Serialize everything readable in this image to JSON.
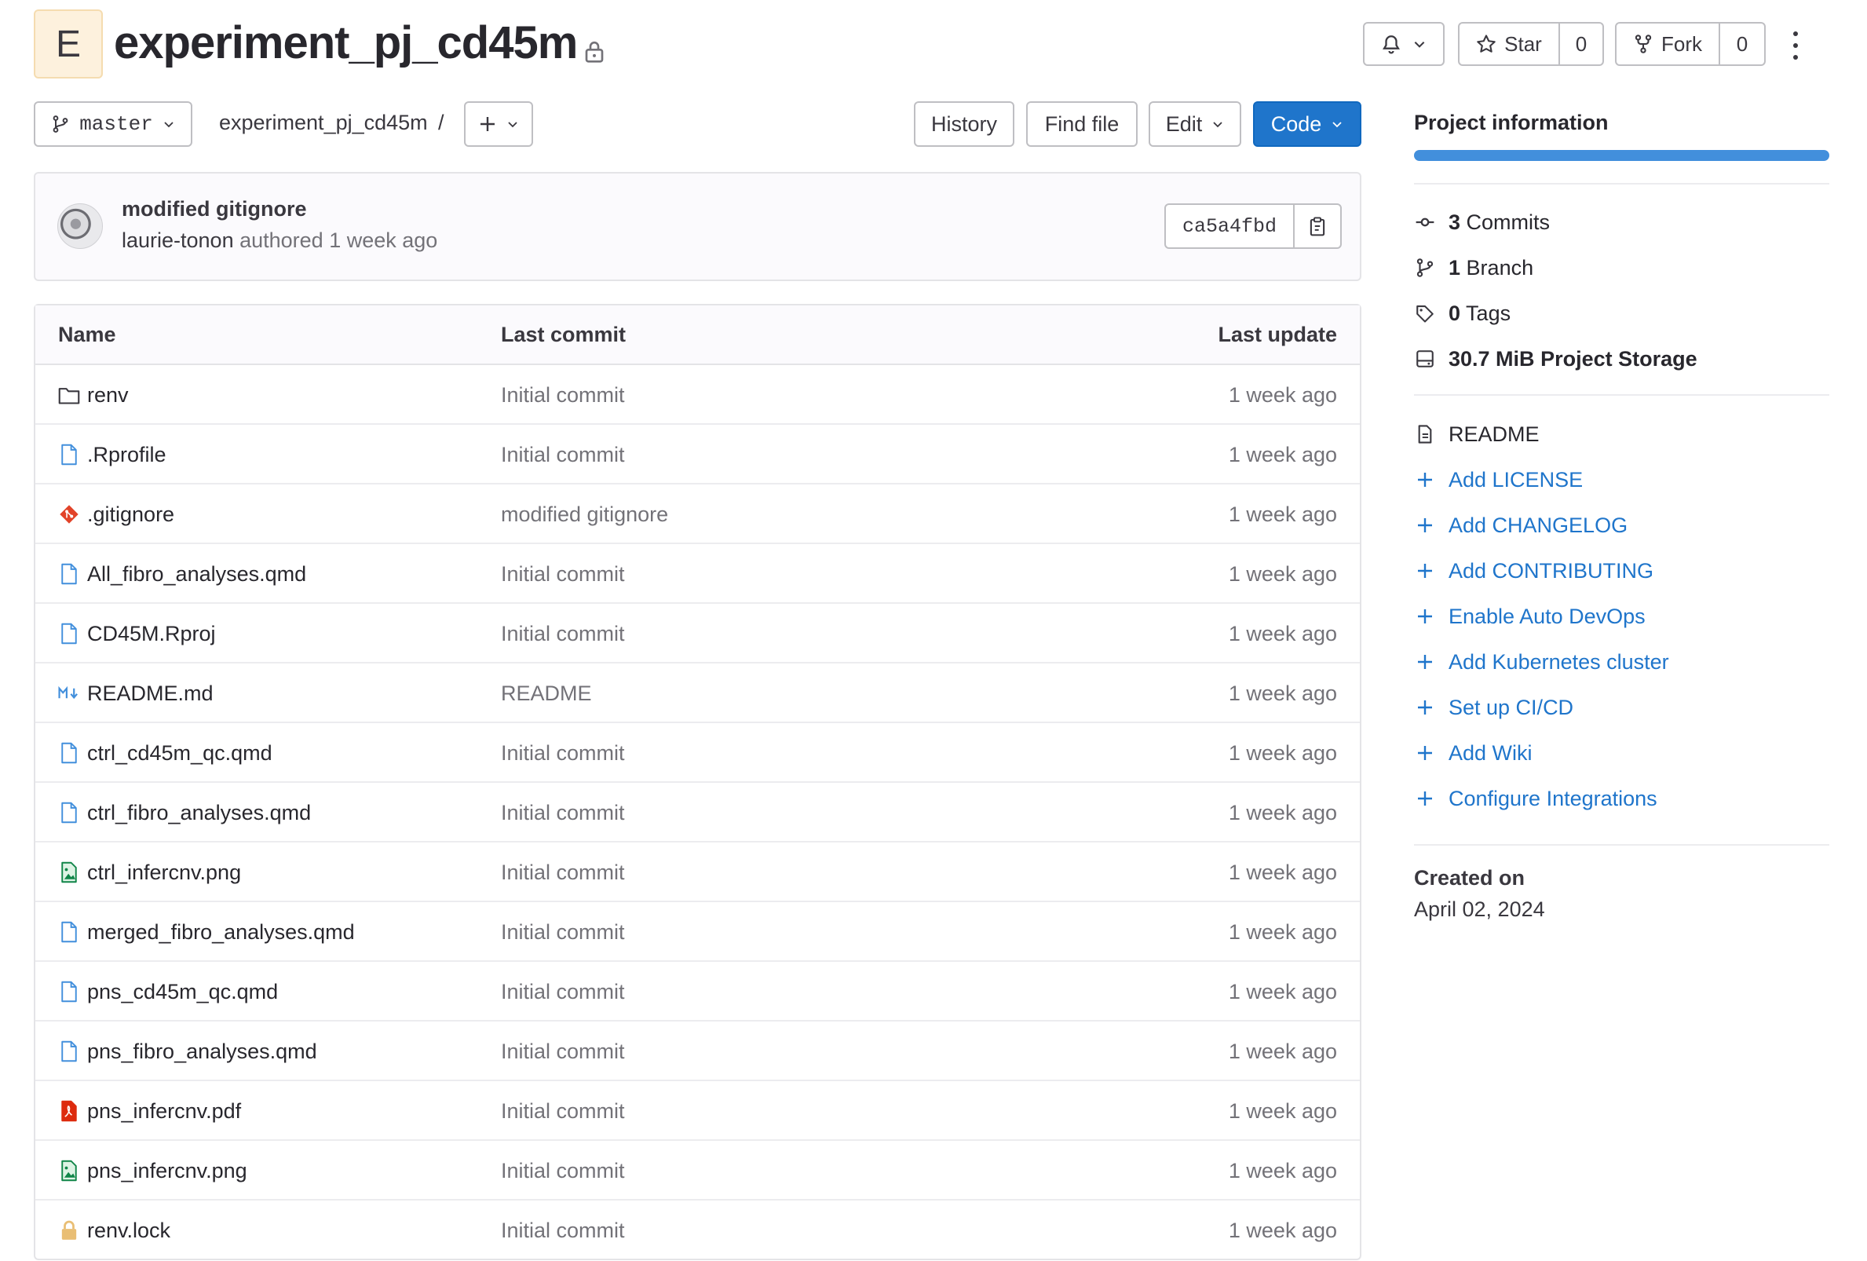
{
  "project": {
    "avatar_letter": "E",
    "title": "experiment_pj_cd45m"
  },
  "header_actions": {
    "star_label": "Star",
    "star_count": "0",
    "fork_label": "Fork",
    "fork_count": "0"
  },
  "toolbar": {
    "branch": "master",
    "breadcrumb": "experiment_pj_cd45m",
    "breadcrumb_sep": "/",
    "history": "History",
    "find_file": "Find file",
    "edit": "Edit",
    "code": "Code"
  },
  "commit": {
    "title": "modified gitignore",
    "author": "laurie-tonon",
    "authored": "authored",
    "time": "1 week ago",
    "sha": "ca5a4fbd"
  },
  "table": {
    "headers": {
      "name": "Name",
      "last_commit": "Last commit",
      "last_update": "Last update"
    },
    "rows": [
      {
        "name": "renv",
        "type": "folder",
        "commit": "Initial commit",
        "updated": "1 week ago"
      },
      {
        "name": ".Rprofile",
        "type": "file",
        "commit": "Initial commit",
        "updated": "1 week ago"
      },
      {
        "name": ".gitignore",
        "type": "git",
        "commit": "modified gitignore",
        "updated": "1 week ago"
      },
      {
        "name": "All_fibro_analyses.qmd",
        "type": "file",
        "commit": "Initial commit",
        "updated": "1 week ago"
      },
      {
        "name": "CD45M.Rproj",
        "type": "file",
        "commit": "Initial commit",
        "updated": "1 week ago"
      },
      {
        "name": "README.md",
        "type": "markdown",
        "commit": "README",
        "updated": "1 week ago"
      },
      {
        "name": "ctrl_cd45m_qc.qmd",
        "type": "file",
        "commit": "Initial commit",
        "updated": "1 week ago"
      },
      {
        "name": "ctrl_fibro_analyses.qmd",
        "type": "file",
        "commit": "Initial commit",
        "updated": "1 week ago"
      },
      {
        "name": "ctrl_infercnv.png",
        "type": "image",
        "commit": "Initial commit",
        "updated": "1 week ago"
      },
      {
        "name": "merged_fibro_analyses.qmd",
        "type": "file",
        "commit": "Initial commit",
        "updated": "1 week ago"
      },
      {
        "name": "pns_cd45m_qc.qmd",
        "type": "file",
        "commit": "Initial commit",
        "updated": "1 week ago"
      },
      {
        "name": "pns_fibro_analyses.qmd",
        "type": "file",
        "commit": "Initial commit",
        "updated": "1 week ago"
      },
      {
        "name": "pns_infercnv.pdf",
        "type": "pdf",
        "commit": "Initial commit",
        "updated": "1 week ago"
      },
      {
        "name": "pns_infercnv.png",
        "type": "image",
        "commit": "Initial commit",
        "updated": "1 week ago"
      },
      {
        "name": "renv.lock",
        "type": "lock",
        "commit": "Initial commit",
        "updated": "1 week ago"
      }
    ]
  },
  "sidebar": {
    "title": "Project information",
    "stats": {
      "commits_count": "3",
      "commits_label": "Commits",
      "branches_count": "1",
      "branches_label": "Branch",
      "tags_count": "0",
      "tags_label": "Tags",
      "storage_value": "30.7 MiB",
      "storage_label": "Project Storage"
    },
    "readme": "README",
    "links": [
      "Add LICENSE",
      "Add CHANGELOG",
      "Add CONTRIBUTING",
      "Enable Auto DevOps",
      "Add Kubernetes cluster",
      "Set up CI/CD",
      "Add Wiki",
      "Configure Integrations"
    ],
    "created_label": "Created on",
    "created_date": "April 02, 2024"
  },
  "colors": {
    "primary": "#1f75cb",
    "progress": "#428fdc",
    "git_icon": "#e24329",
    "pdf_icon": "#dd2b0e",
    "image_icon": "#108548",
    "lock_icon": "#e9be74"
  }
}
